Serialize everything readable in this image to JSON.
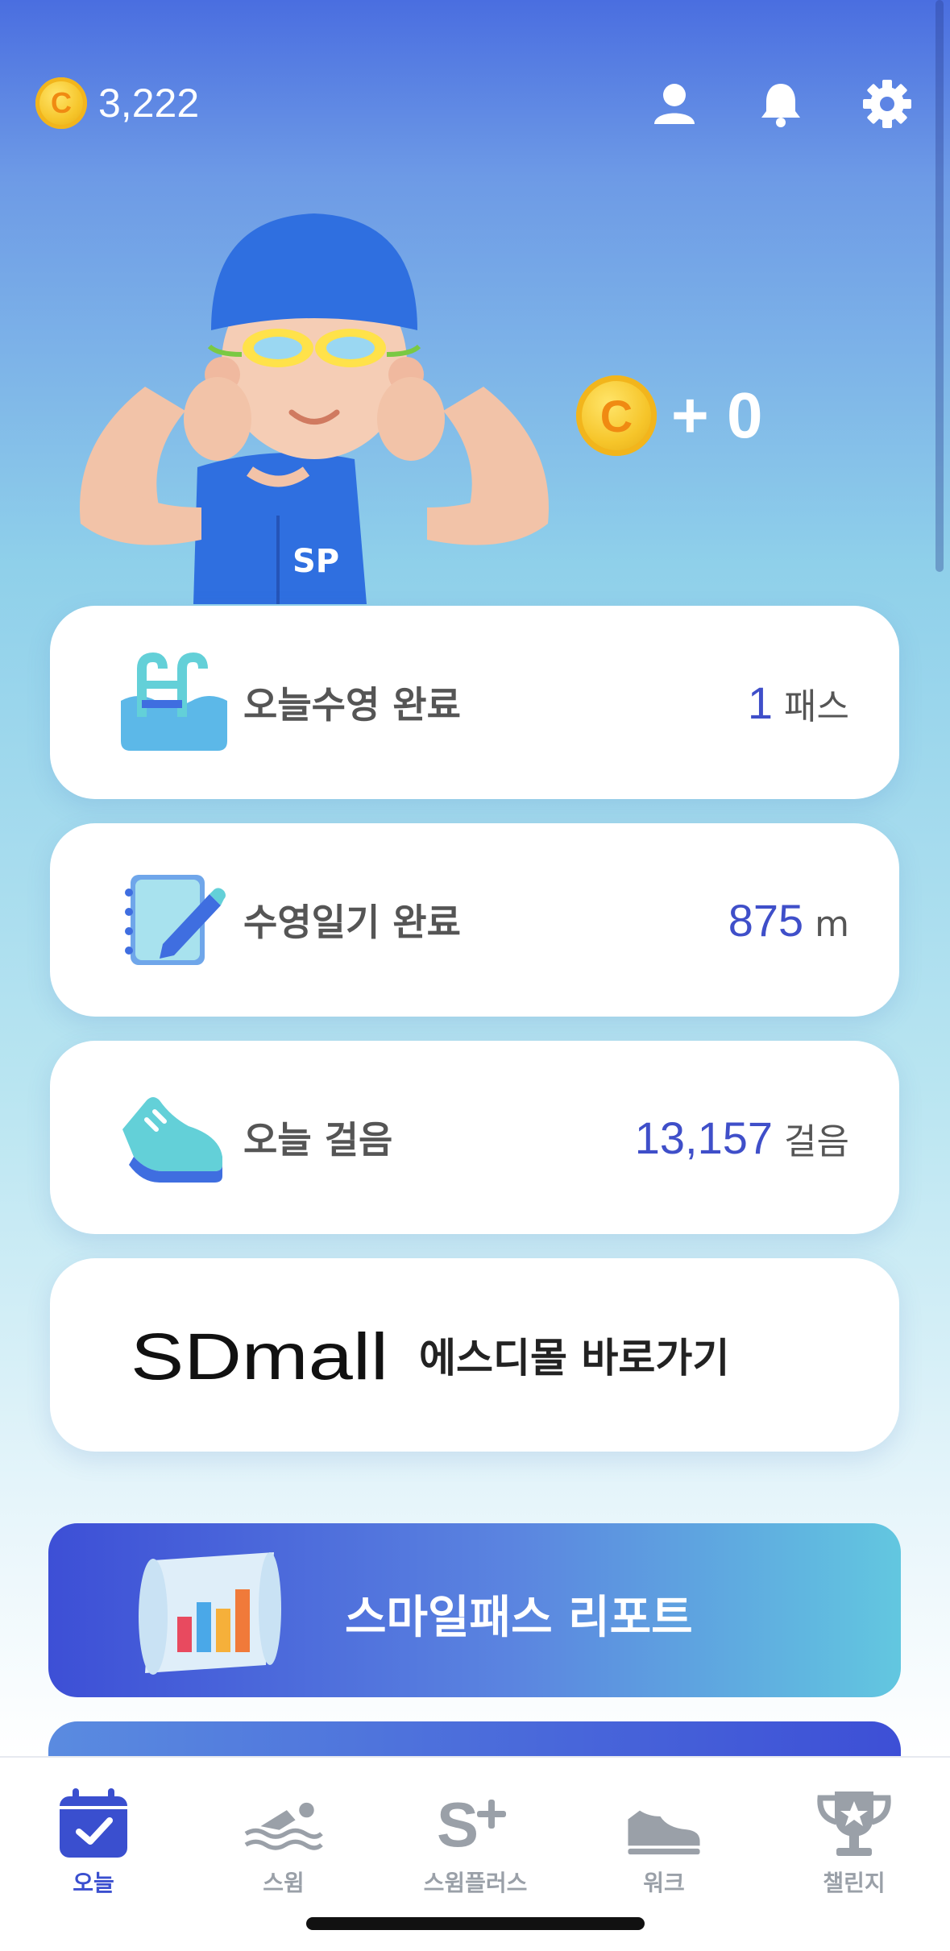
{
  "header": {
    "coin_symbol": "C",
    "coin_balance": "3,222"
  },
  "reward": {
    "coin_symbol": "C",
    "text": "+ 0"
  },
  "mascot": {
    "badge": "SP"
  },
  "cards": [
    {
      "label": "오늘수영 완료",
      "value": "1",
      "unit": "패스"
    },
    {
      "label": "수영일기 완료",
      "value": "875",
      "unit": "m"
    },
    {
      "label": "오늘 걸음",
      "value": "13,157",
      "unit": "걸음"
    }
  ],
  "sdmall": {
    "logo_text": "SDmall",
    "label": "에스디몰 바로가기"
  },
  "report": {
    "label": "스마일패스 리포트"
  },
  "tabs": [
    {
      "label": "오늘",
      "icon": "calendar-check-icon",
      "active": true
    },
    {
      "label": "스윔",
      "icon": "swimmer-icon",
      "active": false
    },
    {
      "label": "스윔플러스",
      "icon": "s-plus-icon",
      "active": false
    },
    {
      "label": "워크",
      "icon": "shoe-icon",
      "active": false
    },
    {
      "label": "챌린지",
      "icon": "trophy-icon",
      "active": false
    }
  ],
  "colors": {
    "accent": "#3f4fc9",
    "tab_active": "#3a4fcf",
    "tab_inactive": "#9aa0a8",
    "coin": "#f6c52a"
  }
}
